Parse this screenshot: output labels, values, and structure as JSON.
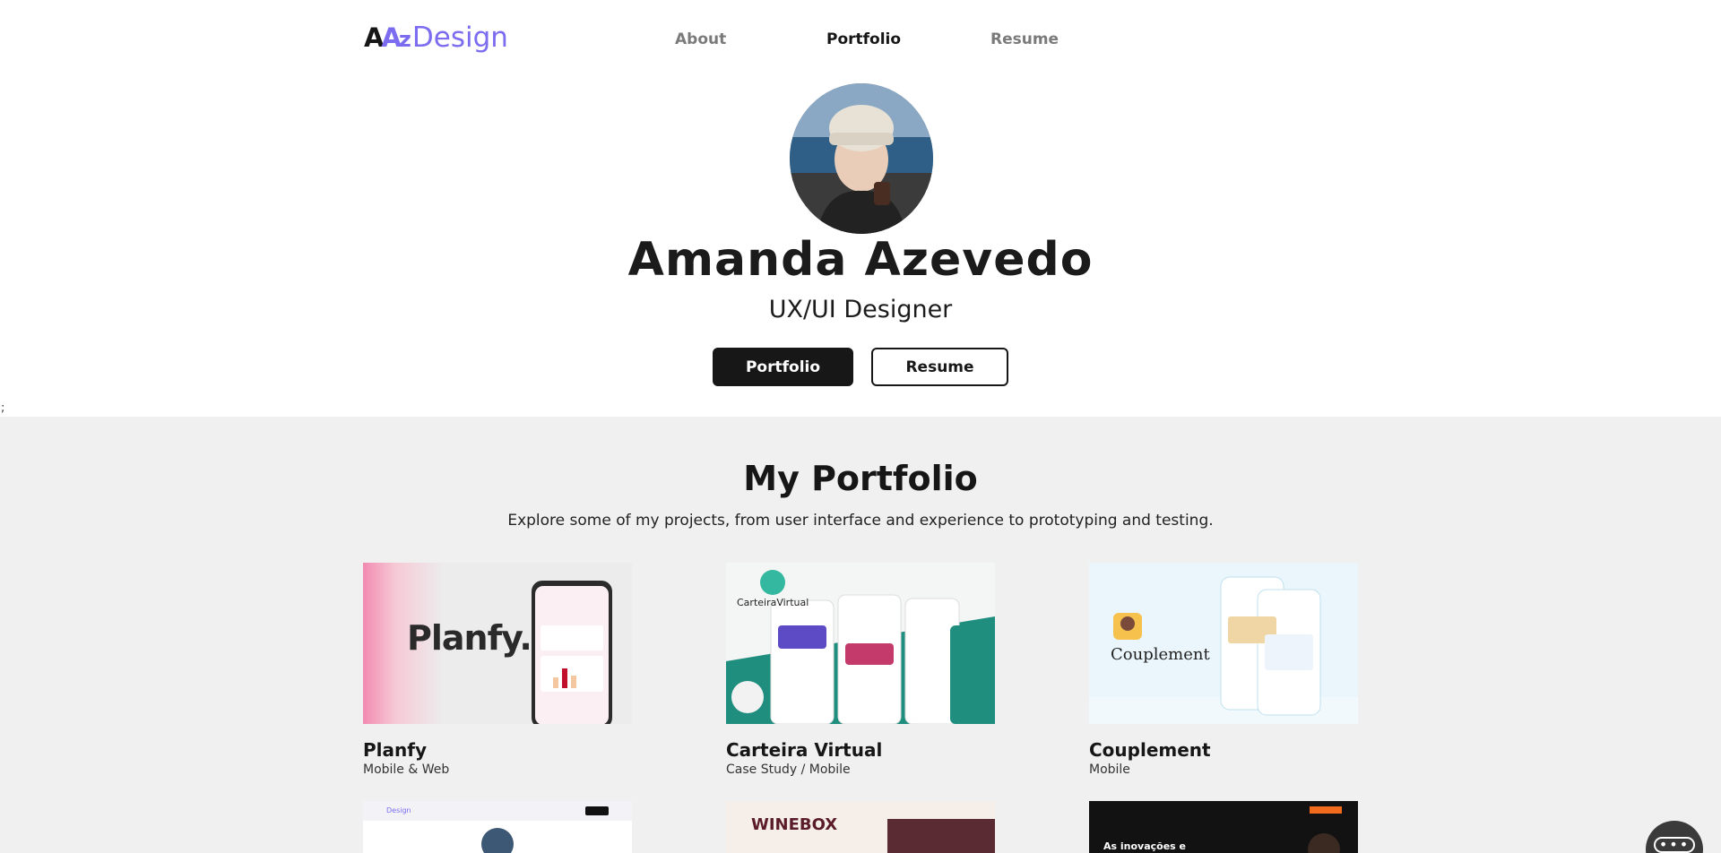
{
  "header": {
    "logo_word": "Design",
    "nav": [
      {
        "label": "About",
        "active": false
      },
      {
        "label": "Portfolio",
        "active": true
      },
      {
        "label": "Resume",
        "active": false
      }
    ]
  },
  "hero": {
    "name": "Amanda Azevedo",
    "role": "UX/UI Designer",
    "primary_button": "Portfolio",
    "secondary_button": "Resume"
  },
  "stray_text": ";",
  "portfolio": {
    "title": "My Portfolio",
    "subtitle": "Explore some of my projects, from user interface and experience to prototyping and testing.",
    "projects": [
      {
        "title": "Planfy",
        "subtitle": "Mobile & Web",
        "thumb_text": "Planfy."
      },
      {
        "title": "Carteira Virtual",
        "subtitle": "Case Study / Mobile",
        "thumb_text": "CarteiraVirtual"
      },
      {
        "title": "Couplement",
        "subtitle": "Mobile",
        "thumb_text": "Couplement"
      },
      {
        "title": "",
        "subtitle": "",
        "thumb_text": "Design"
      },
      {
        "title": "",
        "subtitle": "",
        "thumb_text": "WINEBOX"
      },
      {
        "title": "",
        "subtitle": "",
        "thumb_text": "As inovações e"
      }
    ]
  },
  "colors": {
    "brand_purple": "#7b6cf0",
    "dark": "#171717",
    "section_bg": "#f0f0f0"
  },
  "icons": {
    "chat": "chat-bubble-icon"
  }
}
